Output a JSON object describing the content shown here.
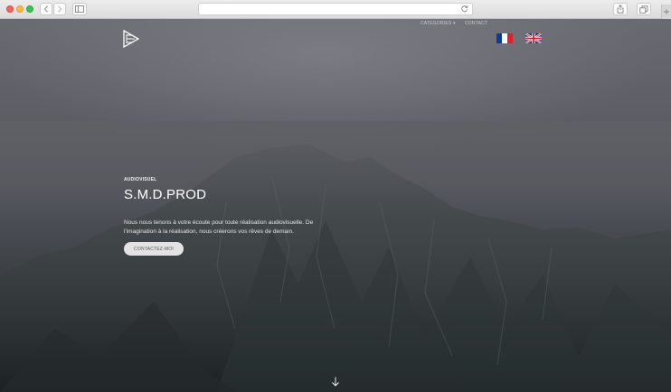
{
  "nav": {
    "categories_label": "CATEGORIES ▾",
    "contact_label": "CONTACT"
  },
  "hero": {
    "kicker": "AUDIOVISUEL",
    "title": "S.M.D.PROD",
    "description": "Nous nous tenons à votre écoute pour toute réalisation audiovisuelle. De l'imagination à la réalisation, nous créerons vos rêves de demain.",
    "cta_label": "CONTACTEZ-MOI"
  },
  "icons": {
    "logo": "play-triangle-logo-icon",
    "flag_fr": "flag-fr-icon",
    "flag_uk": "flag-uk-icon",
    "scroll": "arrow-down-icon"
  },
  "colors": {
    "sky": "#5f6066",
    "mountain": "#2b3032",
    "text": "#ffffff",
    "button": "#e3e3e3"
  }
}
